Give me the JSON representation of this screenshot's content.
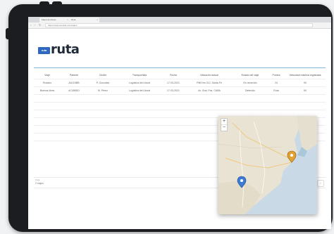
{
  "browser": {
    "tabs": [
      "Mapa de Rutas",
      "Ruta"
    ],
    "url": "https://ruta.example.com/viajes"
  },
  "logo": {
    "badge": "ruta",
    "text": "ruta"
  },
  "table": {
    "headers": [
      "Viaje",
      "Patente",
      "Chofer",
      "Transportista",
      "Fecha",
      "Ubicación actual",
      "Estado del viaje",
      "Puntos",
      "Velocidad máxima registrada"
    ],
    "rows": [
      [
        "Rosario",
        "AA123BB",
        "P. Gonzalez",
        "Logística del Litoral",
        "17-03-2021",
        "RN9 km 312, Santa Fe",
        "En recorrido",
        "24",
        "90"
      ],
      [
        "Buenos Aires",
        "AC456DD",
        "M. Pérez",
        "Logística del Litoral",
        "17-03-2021",
        "Av. Gral. Paz, CABA",
        "Detenido",
        "Ruta",
        "60"
      ]
    ],
    "empty_rows": 6
  },
  "footer": {
    "label": "Total",
    "value": "2 viajes",
    "button": "›"
  },
  "map": {
    "zoom_in": "+",
    "zoom_out": "−",
    "marker_colors": [
      "#e2a22f",
      "#3e7bd6"
    ]
  },
  "colors": {
    "brand": "#2e69bf",
    "accent_rule": "#7fb6d9"
  }
}
